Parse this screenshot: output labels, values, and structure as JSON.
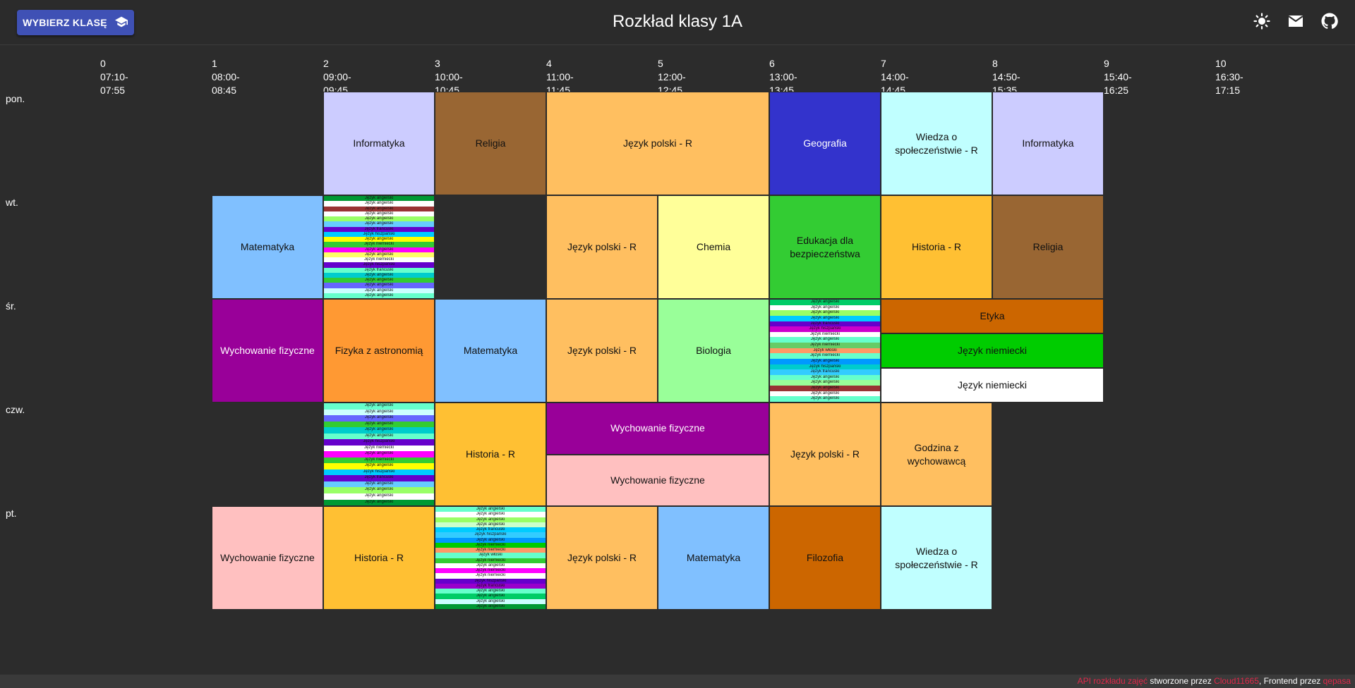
{
  "header": {
    "select_label": "WYBIERZ KLASĘ",
    "title": "Rozkład klasy 1A",
    "icons": [
      "theme-sun-icon",
      "mail-icon",
      "github-icon"
    ]
  },
  "periods": [
    {
      "n": "0",
      "time": "07:10-07:55"
    },
    {
      "n": "1",
      "time": "08:00-08:45"
    },
    {
      "n": "2",
      "time": "09:00-09:45"
    },
    {
      "n": "3",
      "time": "10:00-10:45"
    },
    {
      "n": "4",
      "time": "11:00-11:45"
    },
    {
      "n": "5",
      "time": "12:00-12:45"
    },
    {
      "n": "6",
      "time": "13:00-13:45"
    },
    {
      "n": "7",
      "time": "14:00-14:45"
    },
    {
      "n": "8",
      "time": "14:50-15:35"
    },
    {
      "n": "9",
      "time": "15:40-16:25"
    },
    {
      "n": "10",
      "time": "16:30-17:15"
    }
  ],
  "days": [
    "pon.",
    "wt.",
    "śr.",
    "czw.",
    "pt."
  ],
  "colors": {
    "Informatyka": "#ccccff",
    "Religia": "#996633",
    "Język polski - R": "#ffbf60",
    "Geografia": "#3333cc",
    "Wiedza o społeczeństwie - R": "#c0ffff",
    "Matematyka": "#80c0ff",
    "Chemia": "#ffff99",
    "Edukacja dla bezpieczeństwa": "#33cc33",
    "Historia - R": "#ffc033",
    "Wychowanie fizyczne (purple)": "#990099",
    "Fizyka z astronomią": "#ff9933",
    "Biologia": "#99ff99",
    "Etyka": "#cc6600",
    "Język niemiecki (green)": "#00cc00",
    "Język niemiecki (white)": "#ffffff",
    "Wychowanie fizyczne (pink)": "#ffc0c0",
    "Godzina z wychowawcą": "#ffbf60",
    "Filozofia": "#cc6600"
  },
  "lessons": [
    {
      "day": 0,
      "p": 2,
      "span": 1,
      "label": "Informatyka",
      "color": "#ccccff"
    },
    {
      "day": 0,
      "p": 3,
      "span": 1,
      "label": "Religia",
      "color": "#996633"
    },
    {
      "day": 0,
      "p": 4,
      "span": 2,
      "label": "Język polski - R",
      "color": "#ffbf60"
    },
    {
      "day": 0,
      "p": 6,
      "span": 1,
      "label": "Geografia",
      "color": "#3333cc",
      "white": true
    },
    {
      "day": 0,
      "p": 7,
      "span": 1,
      "label": "Wiedza o społeczeństwie - R",
      "color": "#c0ffff"
    },
    {
      "day": 0,
      "p": 8,
      "span": 1,
      "label": "Informatyka",
      "color": "#ccccff"
    },
    {
      "day": 1,
      "p": 1,
      "span": 1,
      "label": "Matematyka",
      "color": "#80c0ff"
    },
    {
      "day": 1,
      "p": 4,
      "span": 1,
      "label": "Język polski - R",
      "color": "#ffbf60"
    },
    {
      "day": 1,
      "p": 5,
      "span": 1,
      "label": "Chemia",
      "color": "#ffff99"
    },
    {
      "day": 1,
      "p": 6,
      "span": 1,
      "label": "Edukacja dla bezpieczeństwa",
      "color": "#33cc33"
    },
    {
      "day": 1,
      "p": 7,
      "span": 1,
      "label": "Historia - R",
      "color": "#ffc033"
    },
    {
      "day": 1,
      "p": 8,
      "span": 1,
      "label": "Religia",
      "color": "#996633"
    },
    {
      "day": 2,
      "p": 1,
      "span": 1,
      "label": "Wychowanie fizyczne",
      "color": "#990099",
      "white": true
    },
    {
      "day": 2,
      "p": 2,
      "span": 1,
      "label": "Fizyka z astronomią",
      "color": "#ff9933"
    },
    {
      "day": 2,
      "p": 3,
      "span": 1,
      "label": "Matematyka",
      "color": "#80c0ff"
    },
    {
      "day": 2,
      "p": 4,
      "span": 1,
      "label": "Język polski - R",
      "color": "#ffbf60"
    },
    {
      "day": 2,
      "p": 5,
      "span": 1,
      "label": "Biologia",
      "color": "#99ff99"
    },
    {
      "day": 3,
      "p": 3,
      "span": 1,
      "label": "Historia - R",
      "color": "#ffc033"
    },
    {
      "day": 3,
      "p": 6,
      "span": 1,
      "label": "Język polski - R",
      "color": "#ffbf60"
    },
    {
      "day": 3,
      "p": 7,
      "span": 1,
      "label": "Godzina z wychowawcą",
      "color": "#ffbf60"
    },
    {
      "day": 4,
      "p": 1,
      "span": 1,
      "label": "Wychowanie fizyczne",
      "color": "#ffc0c0"
    },
    {
      "day": 4,
      "p": 2,
      "span": 1,
      "label": "Historia - R",
      "color": "#ffc033"
    },
    {
      "day": 4,
      "p": 4,
      "span": 1,
      "label": "Język polski - R",
      "color": "#ffbf60"
    },
    {
      "day": 4,
      "p": 5,
      "span": 1,
      "label": "Matematyka",
      "color": "#80c0ff"
    },
    {
      "day": 4,
      "p": 6,
      "span": 1,
      "label": "Filozofia",
      "color": "#cc6600"
    },
    {
      "day": 4,
      "p": 7,
      "span": 1,
      "label": "Wiedza o społeczeństwie - R",
      "color": "#c0ffff"
    }
  ],
  "stacked": [
    {
      "day": 2,
      "p": 7,
      "span": 2,
      "parts": [
        {
          "label": "Etyka",
          "color": "#cc6600"
        },
        {
          "label": "Język niemiecki",
          "color": "#00cc00"
        },
        {
          "label": "Język niemiecki",
          "color": "#ffffff"
        }
      ]
    },
    {
      "day": 3,
      "p": 4,
      "span": 2,
      "parts": [
        {
          "label": "Wychowanie fizyczne",
          "color": "#990099",
          "white": true
        },
        {
          "label": "Wychowanie fizyczne",
          "color": "#ffc0c0"
        }
      ]
    }
  ],
  "multigroups": [
    {
      "day": 1,
      "p": 2,
      "strips": [
        {
          "label": "Język angielski",
          "color": "#009933"
        },
        {
          "label": "Język angielski",
          "color": "#ffffff"
        },
        {
          "label": "Język angielski",
          "color": "#993333"
        },
        {
          "label": "Język angielski",
          "color": "#ffffff"
        },
        {
          "label": "Język angielski",
          "color": "#99ff66"
        },
        {
          "label": "Język angielski",
          "color": "#66ccff"
        },
        {
          "label": "Język francuski",
          "color": "#6600cc"
        },
        {
          "label": "Język hiszpański",
          "color": "#00ccff"
        },
        {
          "label": "Język angielski",
          "color": "#ffff00"
        },
        {
          "label": "Język niemiecki",
          "color": "#33cc33"
        },
        {
          "label": "Język angielski",
          "color": "#ff00ff"
        },
        {
          "label": "Język angielski",
          "color": "#ffff66"
        },
        {
          "label": "Język niemiecki",
          "color": "#ffffff"
        },
        {
          "label": "Język hiszpański",
          "color": "#6600cc"
        },
        {
          "label": "Język francuski",
          "color": "#66ffcc"
        },
        {
          "label": "Język angielski",
          "color": "#00cccc"
        },
        {
          "label": "Język angielski",
          "color": "#33cc33"
        },
        {
          "label": "Język angielski",
          "color": "#6666ff"
        },
        {
          "label": "Język angielski",
          "color": "#ccffff"
        },
        {
          "label": "Język angielski",
          "color": "#66ffcc"
        }
      ]
    },
    {
      "day": 2,
      "p": 6,
      "strips": [
        {
          "label": "Język angielski",
          "color": "#00cc66"
        },
        {
          "label": "Język angielski",
          "color": "#ffffff"
        },
        {
          "label": "Język angielski",
          "color": "#99ff66"
        },
        {
          "label": "Język angielski",
          "color": "#00ccff"
        },
        {
          "label": "Język francuski",
          "color": "#6600cc"
        },
        {
          "label": "Język hiszpański",
          "color": "#cc00cc"
        },
        {
          "label": "Język niemiecki",
          "color": "#ffffff"
        },
        {
          "label": "Język angielski",
          "color": "#66ffcc"
        },
        {
          "label": "Język niemiecki",
          "color": "#66cc66"
        },
        {
          "label": "Język włoski",
          "color": "#ff9966"
        },
        {
          "label": "Język niemiecki",
          "color": "#66ffcc"
        },
        {
          "label": "Język angielski",
          "color": "#0099ff"
        },
        {
          "label": "Język hiszpański",
          "color": "#00cccc"
        },
        {
          "label": "Język francuski",
          "color": "#33ccff"
        },
        {
          "label": "Język angielski",
          "color": "#66ffcc"
        },
        {
          "label": "Język angielski",
          "color": "#99ff99"
        },
        {
          "label": "Język angielski",
          "color": "#993333"
        },
        {
          "label": "Język angielski",
          "color": "#ffffff"
        },
        {
          "label": "Język angielski",
          "color": "#66ffcc"
        }
      ]
    },
    {
      "day": 3,
      "p": 2,
      "strips": [
        {
          "label": "Język angielski",
          "color": "#66ffcc"
        },
        {
          "label": "Język angielski",
          "color": "#ccffff"
        },
        {
          "label": "Język angielski",
          "color": "#6666ff"
        },
        {
          "label": "Język angielski",
          "color": "#33cc33"
        },
        {
          "label": "Język angielski",
          "color": "#00cccc"
        },
        {
          "label": "Język angielski",
          "color": "#66ffcc"
        },
        {
          "label": "Język hiszpański",
          "color": "#6600cc"
        },
        {
          "label": "Język niemiecki",
          "color": "#ffffff"
        },
        {
          "label": "Język angielski",
          "color": "#ff00ff"
        },
        {
          "label": "Język niemiecki",
          "color": "#33cc33"
        },
        {
          "label": "Język angielski",
          "color": "#ffff00"
        },
        {
          "label": "Język hiszpański",
          "color": "#00ccff"
        },
        {
          "label": "Język francuski",
          "color": "#6600cc"
        },
        {
          "label": "Język angielski",
          "color": "#66ccff"
        },
        {
          "label": "Język angielski",
          "color": "#99ff66"
        },
        {
          "label": "Język angielski",
          "color": "#ffffff"
        },
        {
          "label": "Język angielski",
          "color": "#009933"
        }
      ]
    },
    {
      "day": 4,
      "p": 3,
      "strips": [
        {
          "label": "Język angielski",
          "color": "#66ffcc"
        },
        {
          "label": "Język angielski",
          "color": "#ffffff"
        },
        {
          "label": "Język angielski",
          "color": "#99ff66"
        },
        {
          "label": "Język angielski",
          "color": "#ccffcc"
        },
        {
          "label": "Język francuski",
          "color": "#00ccff"
        },
        {
          "label": "Język hiszpański",
          "color": "#33ccff"
        },
        {
          "label": "Język angielski",
          "color": "#0099ff"
        },
        {
          "label": "Język niemiecki",
          "color": "#00cc00"
        },
        {
          "label": "Język niemiecki",
          "color": "#ff9966"
        },
        {
          "label": "Język włoski",
          "color": "#66ffcc"
        },
        {
          "label": "Język niemiecki",
          "color": "#33cc33"
        },
        {
          "label": "Język angielski",
          "color": "#ffffff"
        },
        {
          "label": "Język niemiecki",
          "color": "#ff00ff"
        },
        {
          "label": "Język niemiecki",
          "color": "#ffffff"
        },
        {
          "label": "Język hiszpański",
          "color": "#6600cc"
        },
        {
          "label": "Język francuski",
          "color": "#9900cc"
        },
        {
          "label": "Język angielski",
          "color": "#66ffcc"
        },
        {
          "label": "Język angielski",
          "color": "#00cc66"
        },
        {
          "label": "Język angielski",
          "color": "#ccffff"
        },
        {
          "label": "Język angielski",
          "color": "#009933"
        }
      ]
    }
  ],
  "footer": {
    "part1": "API rozkładu zajęć",
    "part2": " stworzone przez ",
    "part3": "Cloud11665",
    "part4": ", Frontend przez ",
    "part5": "qepasa"
  }
}
